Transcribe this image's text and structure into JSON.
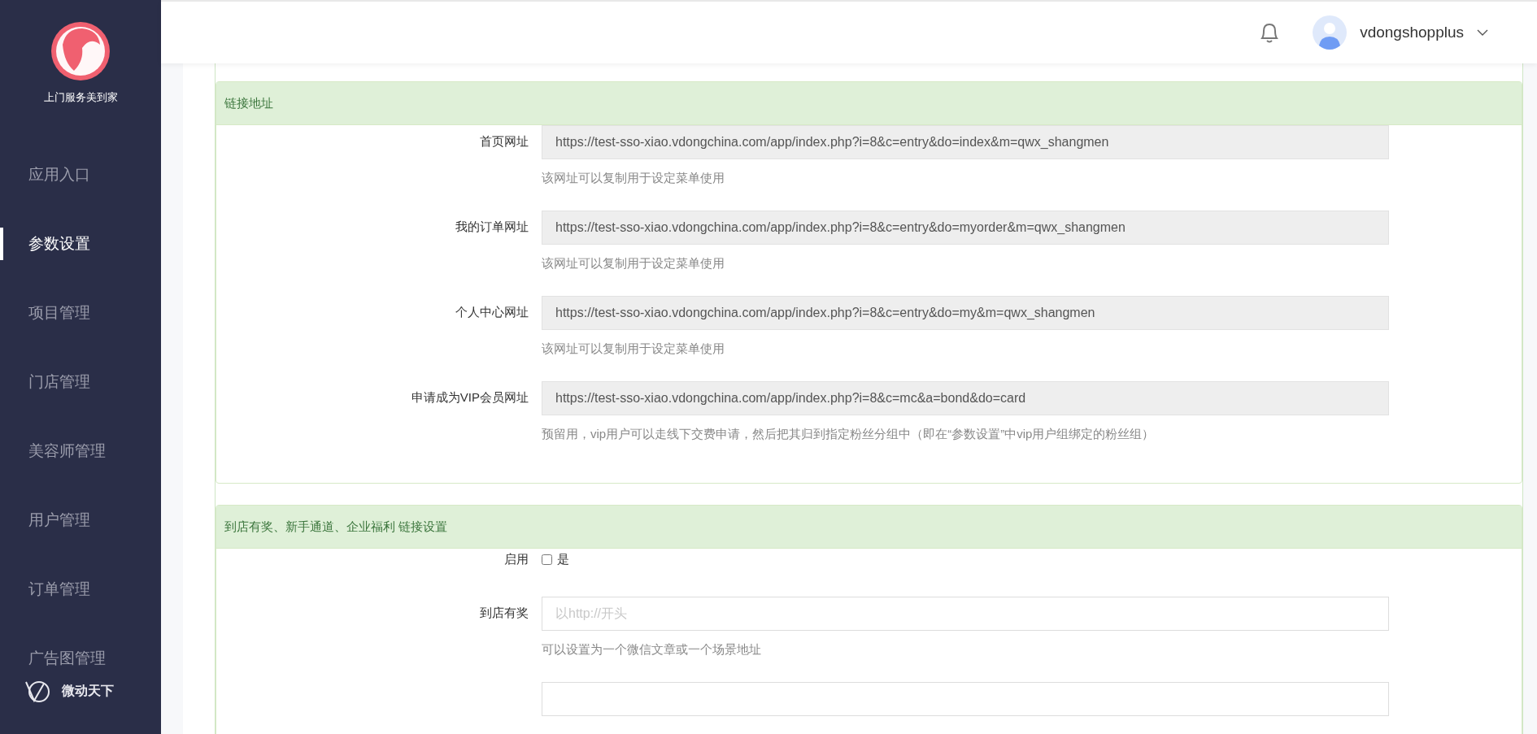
{
  "sidebar": {
    "brand": "上门服务美到家",
    "items": [
      {
        "label": "应用入口",
        "selected": false
      },
      {
        "label": "参数设置",
        "selected": true
      },
      {
        "label": "项目管理",
        "selected": false
      },
      {
        "label": "门店管理",
        "selected": false
      },
      {
        "label": "美容师管理",
        "selected": false
      },
      {
        "label": "用户管理",
        "selected": false
      },
      {
        "label": "订单管理",
        "selected": false
      },
      {
        "label": "广告图管理",
        "selected": false
      }
    ],
    "footer": "微动天下"
  },
  "header": {
    "username": "vdongshopplus"
  },
  "panels": [
    {
      "title": "链接地址",
      "fields": [
        {
          "kind": "readonly",
          "label": "首页网址",
          "value": "https://test-sso-xiao.vdongchina.com/app/index.php?i=8&c=entry&do=index&m=qwx_shangmen",
          "help": "该网址可以复制用于设定菜单使用"
        },
        {
          "kind": "readonly",
          "label": "我的订单网址",
          "value": "https://test-sso-xiao.vdongchina.com/app/index.php?i=8&c=entry&do=myorder&m=qwx_shangmen",
          "help": "该网址可以复制用于设定菜单使用"
        },
        {
          "kind": "readonly",
          "label": "个人中心网址",
          "value": "https://test-sso-xiao.vdongchina.com/app/index.php?i=8&c=entry&do=my&m=qwx_shangmen",
          "help": "该网址可以复制用于设定菜单使用"
        },
        {
          "kind": "readonly",
          "label": "申请成为VIP会员网址",
          "value": "https://test-sso-xiao.vdongchina.com/app/index.php?i=8&c=mc&a=bond&do=card",
          "help": "预留用，vip用户可以走线下交费申请，然后把其归到指定粉丝分组中（即在“参数设置”中vip用户组绑定的粉丝组）"
        }
      ]
    },
    {
      "title": "到店有奖、新手通道、企业福利 链接设置",
      "fields": [
        {
          "kind": "checkbox",
          "label": "启用",
          "option": "是",
          "checked": false
        },
        {
          "kind": "input",
          "label": "到店有奖",
          "placeholder": "以http://开头",
          "help": "可以设置为一个微信文章或一个场景地址"
        },
        {
          "kind": "input"
        }
      ]
    }
  ]
}
